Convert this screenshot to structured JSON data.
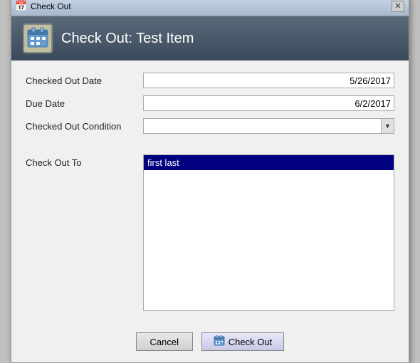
{
  "window": {
    "title": "Check Out",
    "title_icon": "📅"
  },
  "header": {
    "title": "Check Out: Test Item",
    "icon": "📅"
  },
  "form": {
    "checked_out_date_label": "Checked Out Date",
    "checked_out_date_value": "5/26/2017",
    "due_date_label": "Due Date",
    "due_date_value": "6/2/2017",
    "checked_out_condition_label": "Checked Out Condition",
    "checked_out_condition_value": "",
    "check_out_to_label": "Check Out To",
    "check_out_to_selected": "first last"
  },
  "buttons": {
    "cancel_label": "Cancel",
    "checkout_label": "Check Out",
    "checkout_icon": "📅"
  }
}
